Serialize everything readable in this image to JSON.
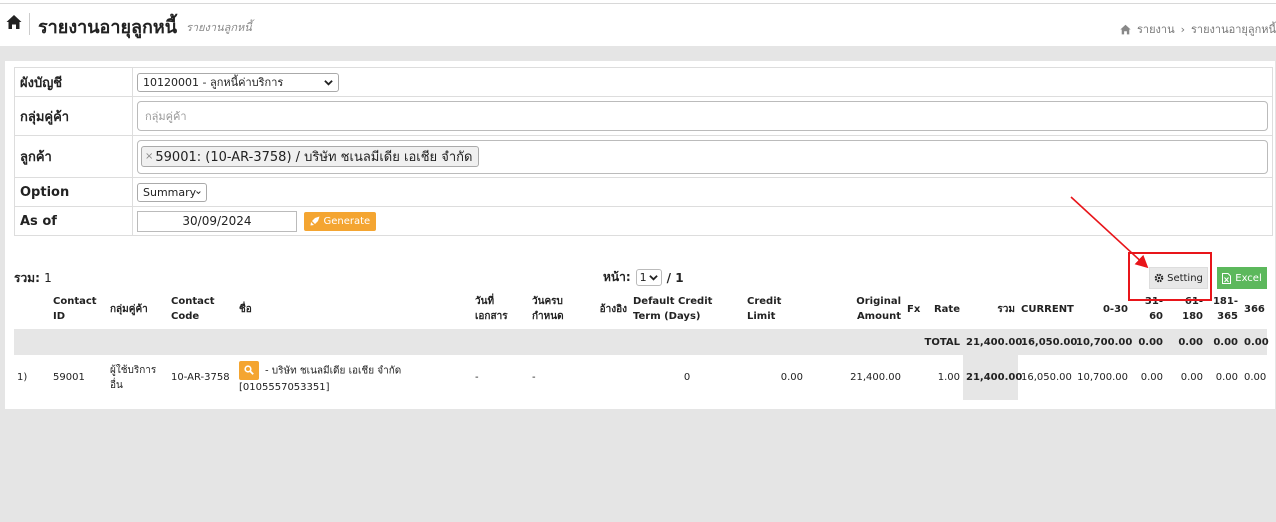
{
  "header": {
    "title": "รายงานอายุลูกหนี้",
    "subtitle": "รายงานลูกหนี้",
    "breadcrumb": [
      "รายงาน",
      "›",
      "รายงานอายุลูกหนี้"
    ]
  },
  "form": {
    "account_label": "ผังบัญชี",
    "account_value": "10120001 - ลูกหนี้ค่าบริการ",
    "group_label": "กลุ่มคู่ค้า",
    "group_placeholder": "กลุ่มคู่ค้า",
    "customer_label": "ลูกค้า",
    "customer_tag_remove": "×",
    "customer_tag": "59001: (10-AR-3758) / บริษัท ชเนลมีเดีย เอเชีย จำกัด",
    "option_label": "Option",
    "option_value": "Summary",
    "asof_label": "As of",
    "asof_value": "30/09/2024",
    "generate_label": "Generate"
  },
  "toolbar": {
    "total_label": "รวม:",
    "total_value": "1",
    "page_label": "หน้า:",
    "page_value": "1",
    "page_of": "/ 1",
    "setting_label": "Setting",
    "excel_label": "Excel"
  },
  "table": {
    "columns": [
      "",
      "Contact ID",
      "กลุ่มคู่ค้า",
      "Contact Code",
      "ชื่อ",
      "วันที่ เอกสาร",
      "วันครบ กำหนด",
      "อ้างอิง",
      "Default Credit Term (Days)",
      "Credit Limit",
      "Original Amount",
      "Fx",
      "Rate",
      "รวม",
      "CURRENT",
      "0-30",
      "31- 60",
      "61- 180",
      "181- 365",
      "366"
    ],
    "total_row": {
      "label": "TOTAL",
      "sum": "21,400.00",
      "current": "16,050.00",
      "d0_30": "10,700.00",
      "d31_60": "0.00",
      "d61_180": "0.00",
      "d181_365": "0.00",
      "d366": "0.00"
    },
    "rows": [
      {
        "no": "1)",
        "contact_id": "59001",
        "group": "ผู้ใช้บริการอื่น",
        "code": "10-AR-3758",
        "name": "- บริษัท ชเนลมีเดีย เอเชีย จำกัด",
        "tax_id": "[0105557053351]",
        "doc_date": "-",
        "due_date": "-",
        "ref": "",
        "credit_term": "0",
        "credit_limit": "0.00",
        "original_amount": "21,400.00",
        "fx": "",
        "rate": "1.00",
        "sum": "21,400.00",
        "current": "16,050.00",
        "d0_30": "10,700.00",
        "d31_60": "0.00",
        "d61_180": "0.00",
        "d181_365": "0.00",
        "d366": "0.00"
      }
    ]
  },
  "colors": {
    "accent_orange": "#f4a531",
    "excel_green": "#5cb85c",
    "annotation_red": "#e8151a"
  },
  "icons": [
    "home-icon",
    "chevron-down-icon",
    "rocket-icon",
    "gear-icon",
    "excel-file-icon",
    "search-icon"
  ]
}
